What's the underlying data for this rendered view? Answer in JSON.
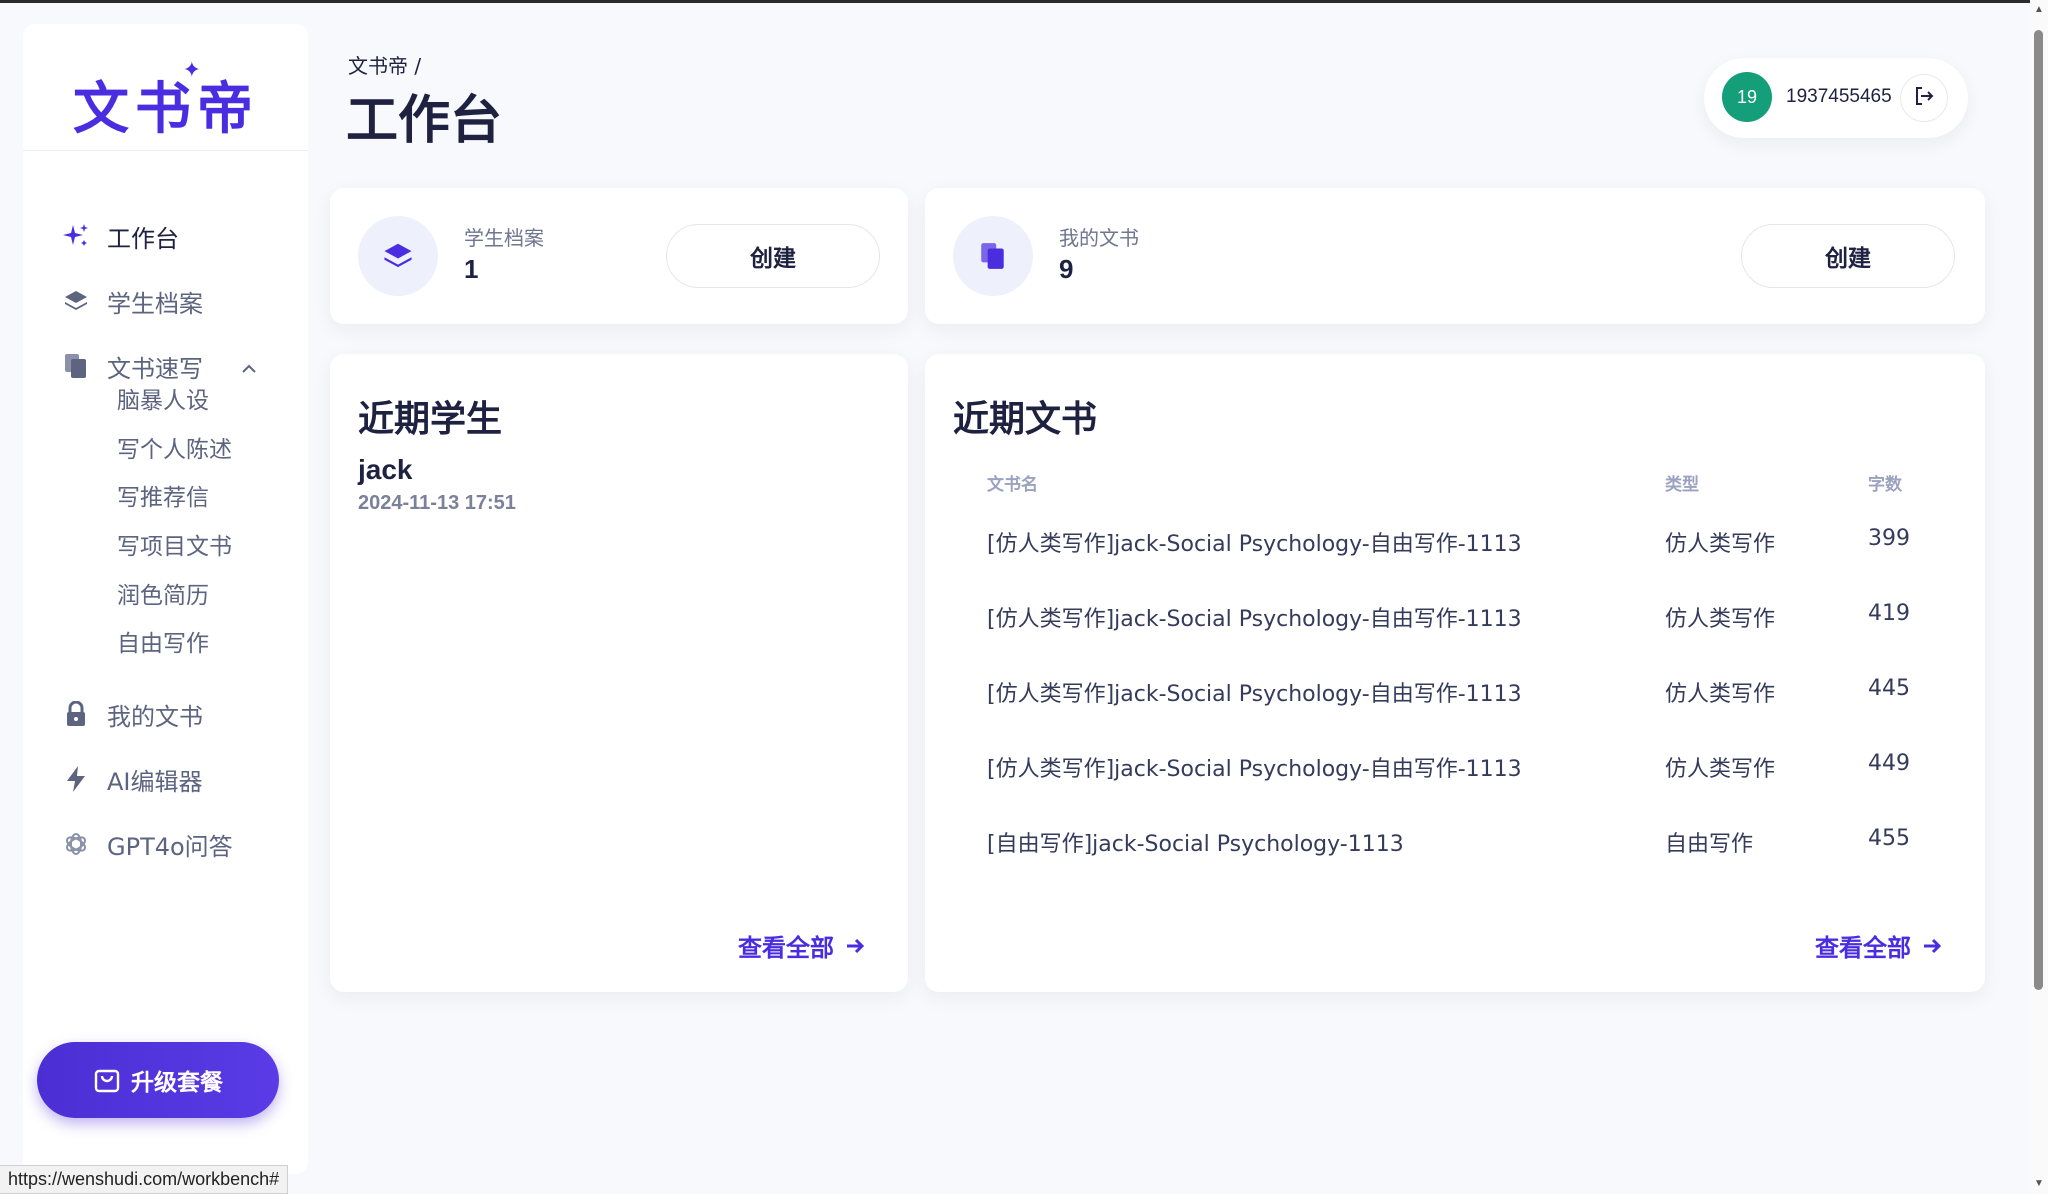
{
  "app": {
    "logo": "文书帝",
    "status_url": "https://wenshudi.com/workbench#"
  },
  "sidebar": {
    "items": [
      {
        "label": "工作台",
        "icon": "sparkle-icon"
      },
      {
        "label": "学生档案",
        "icon": "layers-icon"
      },
      {
        "label": "文书速写",
        "icon": "documents-icon"
      },
      {
        "label": "我的文书",
        "icon": "lock-icon"
      },
      {
        "label": "AI编辑器",
        "icon": "lightning-icon"
      },
      {
        "label": "GPT4o问答",
        "icon": "openai-icon"
      }
    ],
    "subitems": [
      "脑暴人设",
      "写个人陈述",
      "写推荐信",
      "写项目文书",
      "润色简历",
      "自由写作"
    ],
    "upgrade_label": "升级套餐"
  },
  "header": {
    "breadcrumb": "文书帝  /",
    "title": "工作台",
    "user": {
      "avatar_text": "19",
      "phone": "1937455465"
    }
  },
  "stats": {
    "students": {
      "label": "学生档案",
      "value": "1",
      "button": "创建"
    },
    "docs": {
      "label": "我的文书",
      "value": "9",
      "button": "创建"
    }
  },
  "recent_students": {
    "title": "近期学生",
    "items": [
      {
        "name": "jack",
        "time": "2024-11-13 17:51"
      }
    ],
    "view_all": "查看全部"
  },
  "recent_docs": {
    "title": "近期文书",
    "columns": [
      "文书名",
      "类型",
      "字数"
    ],
    "rows": [
      {
        "name": "[仿人类写作]jack-Social Psychology-自由写作-1113",
        "type": "仿人类写作",
        "count": "399"
      },
      {
        "name": "[仿人类写作]jack-Social Psychology-自由写作-1113",
        "type": "仿人类写作",
        "count": "419"
      },
      {
        "name": "[仿人类写作]jack-Social Psychology-自由写作-1113",
        "type": "仿人类写作",
        "count": "445"
      },
      {
        "name": "[仿人类写作]jack-Social Psychology-自由写作-1113",
        "type": "仿人类写作",
        "count": "449"
      },
      {
        "name": "[自由写作]jack-Social Psychology-1113",
        "type": "自由写作",
        "count": "455"
      }
    ],
    "view_all": "查看全部"
  },
  "colors": {
    "brand": "#4a2de0",
    "avatar": "#149e79"
  }
}
